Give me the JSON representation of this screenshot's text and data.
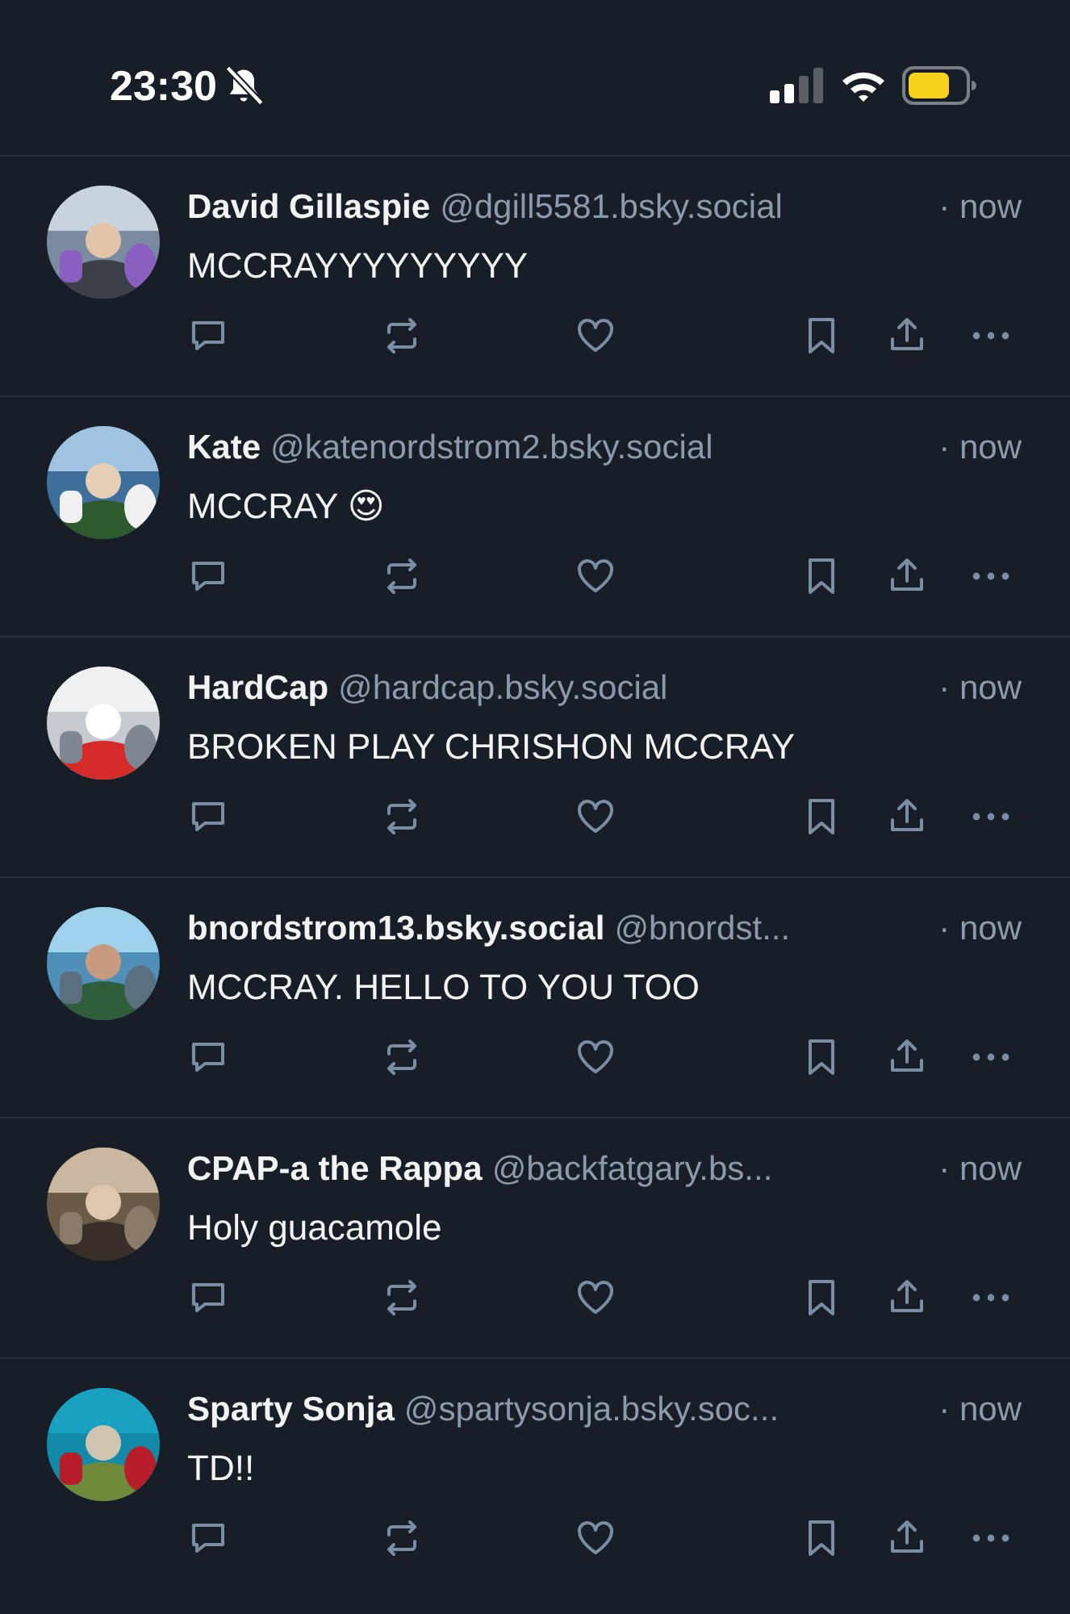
{
  "status_bar": {
    "time": "23:30",
    "silent": true
  },
  "posts": [
    {
      "name": "David Gillaspie",
      "handle": "@dgill5581.bsky.social",
      "time": "· now",
      "text": "MCCRAYYYYYYYYY"
    },
    {
      "name": "Kate",
      "handle": "@katenordstrom2.bsky.social",
      "time": "· now",
      "text": "MCCRAY 😍"
    },
    {
      "name": "HardCap",
      "handle": "@hardcap.bsky.social",
      "time": "· now",
      "text": "BROKEN PLAY CHRISHON MCCRAY"
    },
    {
      "name": "bnordstrom13.bsky.social",
      "handle": "@bnordst...",
      "time": "· now",
      "text": "MCCRAY. HELLO TO YOU TOO"
    },
    {
      "name": "CPAP-a the Rappa",
      "handle": "@backfatgary.bs...",
      "time": "· now",
      "text": "Holy guacamole"
    },
    {
      "name": "Sparty Sonja",
      "handle": "@spartysonja.bsky.soc...",
      "time": "· now",
      "text": "TD!!"
    }
  ]
}
